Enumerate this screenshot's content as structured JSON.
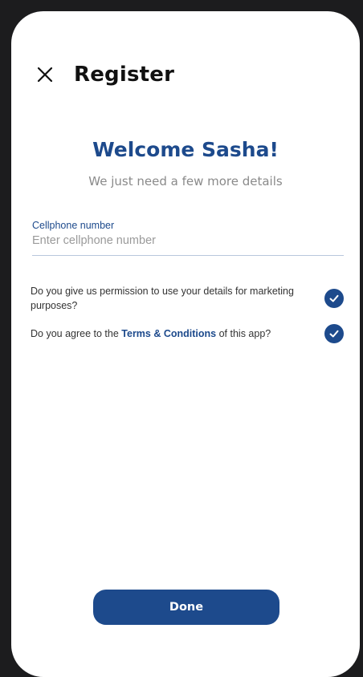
{
  "header": {
    "title": "Register",
    "close_icon": "close-icon"
  },
  "welcome": {
    "title": "Welcome Sasha!",
    "subtitle": "We just need a few more details"
  },
  "form": {
    "cellphone": {
      "label": "Cellphone number",
      "placeholder": "Enter cellphone number",
      "value": ""
    }
  },
  "consents": [
    {
      "text": "Do you give us permission to use your details for marketing purposes?",
      "checked": true
    },
    {
      "text_before": "Do you agree to the ",
      "link": "Terms & Conditions",
      "text_after": " of this app?",
      "checked": true
    }
  ],
  "actions": {
    "done_label": "Done"
  },
  "colors": {
    "primary": "#1d4a8c",
    "background": "#ffffff",
    "frame": "#1c1c1e"
  }
}
